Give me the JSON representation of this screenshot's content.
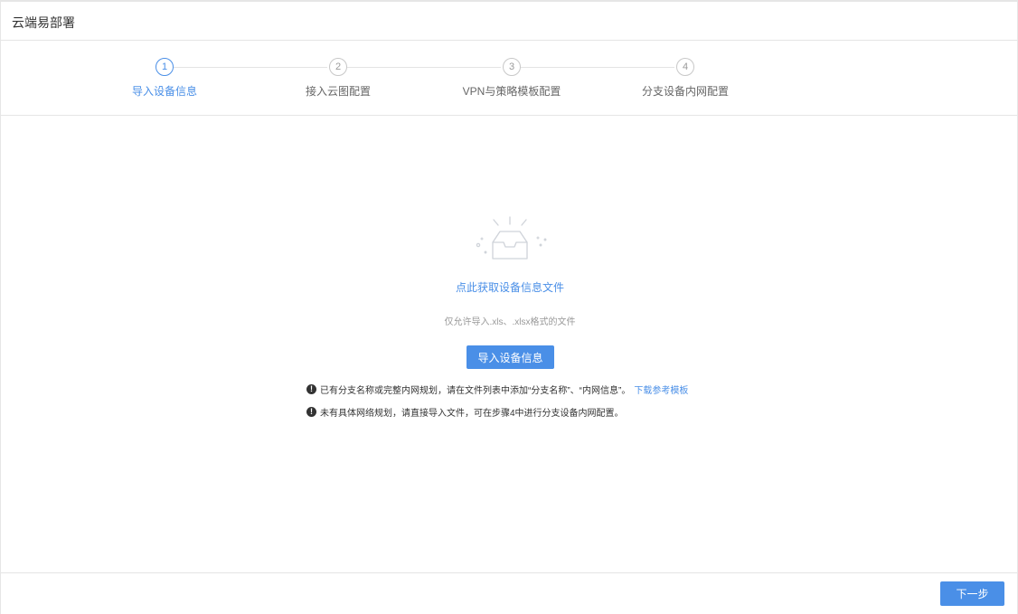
{
  "header": {
    "title": "云端易部署"
  },
  "steps": [
    {
      "number": "1",
      "label": "导入设备信息",
      "active": true
    },
    {
      "number": "2",
      "label": "接入云图配置",
      "active": false
    },
    {
      "number": "3",
      "label": "VPN与策略模板配置",
      "active": false
    },
    {
      "number": "4",
      "label": "分支设备内网配置",
      "active": false
    }
  ],
  "upload": {
    "icon": "empty-inbox-icon",
    "get_file_link": "点此获取设备信息文件",
    "hint": "仅允许导入.xls、.xlsx格式的文件",
    "import_button": "导入设备信息"
  },
  "notes": [
    {
      "icon": "warning-icon",
      "text": "已有分支名称或完整内网规划，请在文件列表中添加“分支名称”、“内网信息”。",
      "link": "下载参考模板"
    },
    {
      "icon": "warning-icon",
      "text": "未有具体网络规划，请直接导入文件，可在步骤4中进行分支设备内网配置。"
    }
  ],
  "footer": {
    "next_button": "下一步"
  },
  "colors": {
    "accent": "#4a8fe7",
    "border": "#e5e5e5",
    "muted": "#999999"
  }
}
